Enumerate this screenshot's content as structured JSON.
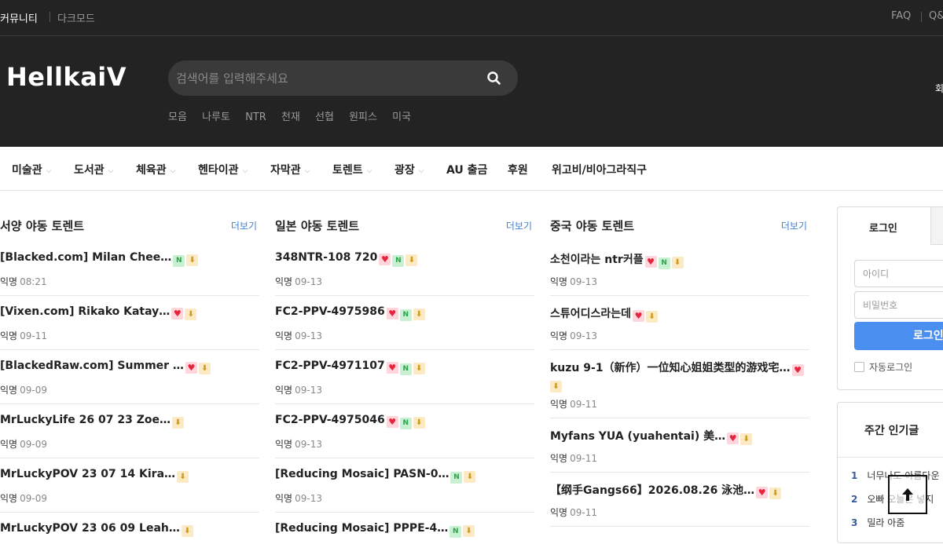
{
  "topbar": {
    "community": "커뮤니티",
    "darkmode": "다크모드",
    "faq": "FAQ",
    "qa": "Q&"
  },
  "header": {
    "logo": "HellkaiV",
    "search_placeholder": "검색어를 입력해주세요",
    "tags": [
      "모음",
      "나루토",
      "NTR",
      "천재",
      "선협",
      "원피스",
      "미국"
    ],
    "right_text": "회"
  },
  "nav": {
    "items": [
      {
        "label": "미술관"
      },
      {
        "label": "도서관"
      },
      {
        "label": "체육관"
      },
      {
        "label": "헨타이관"
      },
      {
        "label": "자막관"
      },
      {
        "label": "토렌트"
      },
      {
        "label": "광장"
      },
      {
        "label": "AU 출금"
      },
      {
        "label": "후원"
      },
      {
        "label": "위고비/비아그라직구"
      }
    ]
  },
  "columns": [
    {
      "title": "서양 야동 토렌트",
      "more": "더보기",
      "posts": [
        {
          "title": "[Blacked.com] Milan Chee…",
          "author": "익명",
          "date": "08:21"
        },
        {
          "title": "[Vixen.com] Rikako Katay…",
          "author": "익명",
          "date": "09-11"
        },
        {
          "title": "[BlackedRaw.com] Summer …",
          "author": "익명",
          "date": "09-09"
        },
        {
          "title": "MrLuckyLife 26 07 23 Zoe…",
          "author": "익명",
          "date": "09-09"
        },
        {
          "title": "MrLuckyPOV 23 07 14 Kira…",
          "author": "익명",
          "date": "09-09"
        },
        {
          "title": "MrLuckyPOV 23 06 09 Leah…",
          "author": "익명",
          "date": ""
        }
      ]
    },
    {
      "title": "일본 야동 토렌트",
      "more": "더보기",
      "posts": [
        {
          "title": "348NTR-108 720",
          "author": "익명",
          "date": "09-13"
        },
        {
          "title": "FC2-PPV-4975986",
          "author": "익명",
          "date": "09-13"
        },
        {
          "title": "FC2-PPV-4971107",
          "author": "익명",
          "date": "09-13"
        },
        {
          "title": "FC2-PPV-4975046",
          "author": "익명",
          "date": "09-13"
        },
        {
          "title": "[Reducing Mosaic] PASN-0…",
          "author": "익명",
          "date": "09-13"
        },
        {
          "title": "[Reducing Mosaic] PPPE-4…",
          "author": "익명",
          "date": ""
        }
      ]
    },
    {
      "title": "중국 야동 토렌트",
      "more": "더보기",
      "posts": [
        {
          "title": "소천이라는 ntr커플",
          "author": "익명",
          "date": "09-13"
        },
        {
          "title": "스튜어디스라는데",
          "author": "익명",
          "date": "09-13"
        },
        {
          "title": "kuzu 9-1（新作）一位知心姐姐类型的游戏宅…",
          "author": "익명",
          "date": "09-11"
        },
        {
          "title": "Myfans YUA (yuahentai) 美…",
          "author": "익명",
          "date": "09-11"
        },
        {
          "title": "【纲手Gangs66】2026.08.26 泳池…",
          "author": "익명",
          "date": "09-11"
        }
      ]
    }
  ],
  "login": {
    "tab_label": "로그인",
    "id_placeholder": "아이디",
    "pw_placeholder": "비밀번호",
    "button": "로그인",
    "auto_login": "자동로그인"
  },
  "weekly": {
    "title": "주간 인기글",
    "items": [
      {
        "rank": "1",
        "title": "너무나도 아름다운"
      },
      {
        "rank": "2",
        "title": "오빠 오늘은 넣지 "
      },
      {
        "rank": "3",
        "title": "밀라 아줌"
      }
    ]
  },
  "icons": [
    "search-icon",
    "chevron-down-icon",
    "new-badge-icon",
    "heart-icon",
    "download-icon",
    "arrow-up-icon"
  ],
  "colors": {
    "accent": "#4a8ef0",
    "link": "#3f7fd6",
    "dark_header": "#232323"
  }
}
